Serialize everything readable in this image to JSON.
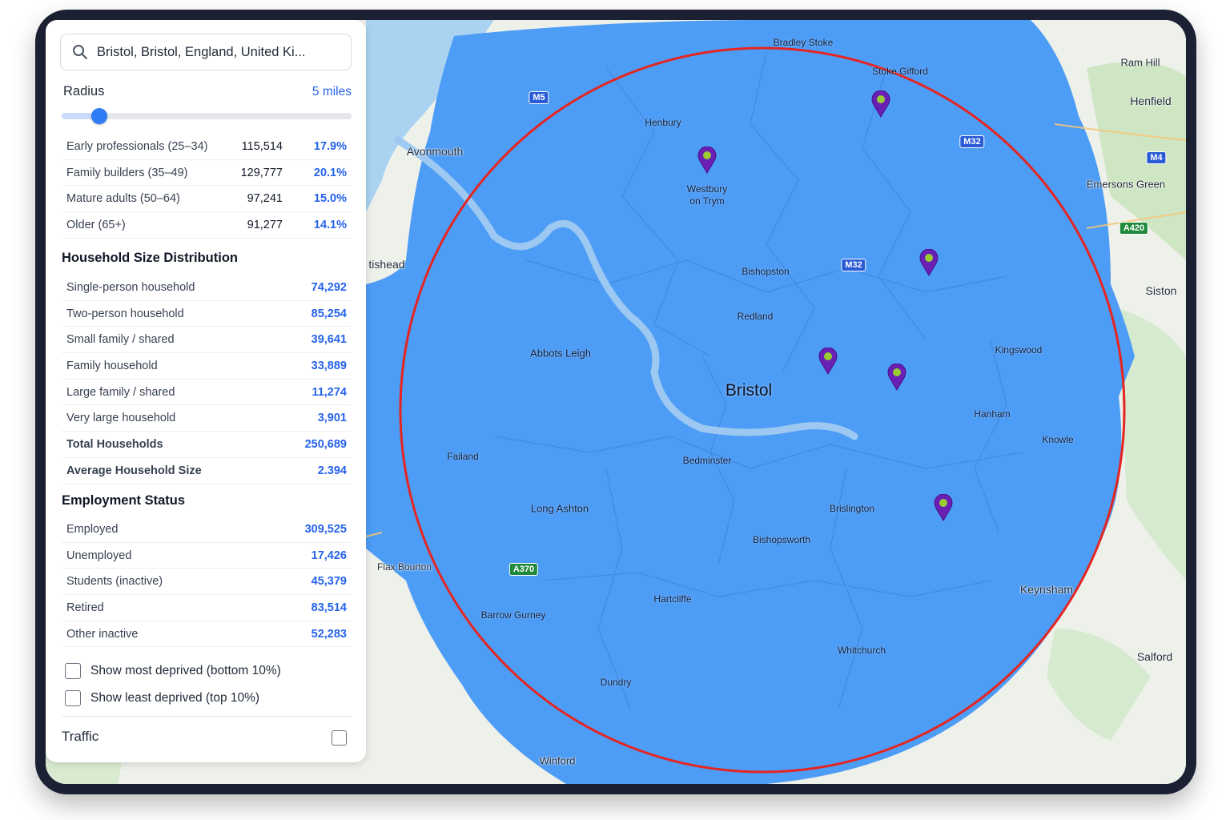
{
  "search": {
    "value": "Bristol, Bristol, England, United Ki..."
  },
  "radius": {
    "label": "Radius",
    "value_label": "5 miles",
    "level": 0.13
  },
  "age_groups": [
    {
      "name": "Early professionals (25–34)",
      "count": "115,514",
      "pct": "17.9%"
    },
    {
      "name": "Family builders (35–49)",
      "count": "129,777",
      "pct": "20.1%"
    },
    {
      "name": "Mature adults (50–64)",
      "count": "97,241",
      "pct": "15.0%"
    },
    {
      "name": "Older (65+)",
      "count": "91,277",
      "pct": "14.1%"
    }
  ],
  "household": {
    "title": "Household Size Distribution",
    "rows": [
      {
        "name": "Single-person household",
        "value": "74,292"
      },
      {
        "name": "Two-person household",
        "value": "85,254"
      },
      {
        "name": "Small family / shared",
        "value": "39,641"
      },
      {
        "name": "Family household",
        "value": "33,889"
      },
      {
        "name": "Large family / shared",
        "value": "11,274"
      },
      {
        "name": "Very large household",
        "value": "3,901"
      },
      {
        "name": "Total Households",
        "value": "250,689"
      },
      {
        "name": "Average Household Size",
        "value": "2.394"
      }
    ]
  },
  "employment": {
    "title": "Employment Status",
    "rows": [
      {
        "name": "Employed",
        "value": "309,525"
      },
      {
        "name": "Unemployed",
        "value": "17,426"
      },
      {
        "name": "Students (inactive)",
        "value": "45,379"
      },
      {
        "name": "Retired",
        "value": "83,514"
      },
      {
        "name": "Other inactive",
        "value": "52,283"
      }
    ]
  },
  "filters": {
    "most_deprived": "Show most deprived (bottom 10%)",
    "least_deprived": "Show least deprived (top 10%)"
  },
  "traffic": {
    "label": "Traffic"
  },
  "map": {
    "city": "Bristol",
    "places": {
      "bradley_stoke": "Bradley Stoke",
      "stoke_gifford": "Stoke Gifford",
      "ram_hill": "Ram Hill",
      "henfield": "Henfield",
      "henbury": "Henbury",
      "avonmouth": "Avonmouth",
      "westbury": "Westbury",
      "on_trym": "on Trym",
      "emersons_green": "Emersons Green",
      "portishead": "tishead",
      "bishopston": "Bishopston",
      "siston": "Siston",
      "redland": "Redland",
      "abbots_leigh": "Abbots Leigh",
      "kingswood": "Kingswood",
      "hanham": "Hanham",
      "knowle": "Knowle",
      "failand": "Failand",
      "bedminster": "Bedminster",
      "long_ashton": "Long Ashton",
      "brislington": "Brislington",
      "bishopsworth": "Bishopsworth",
      "flax_bourton": "Flax Bourton",
      "keynsham": "Keynsham",
      "hartcliffe": "Hartcliffe",
      "barrow_gurney": "Barrow Gurney",
      "whitchurch": "Whitchurch",
      "salford": "Salford",
      "dundry": "Dundry",
      "winford": "Winford"
    },
    "roads": {
      "m5": "M5",
      "m32_a": "M32",
      "m32_b": "M32",
      "m4": "M4",
      "a420": "A420",
      "a370": "A370"
    },
    "colors": {
      "coverage": "#4d9cf5",
      "radius_ring": "#e52521",
      "pin": "#6a1fb5",
      "pin_dot": "#9acd32"
    }
  }
}
